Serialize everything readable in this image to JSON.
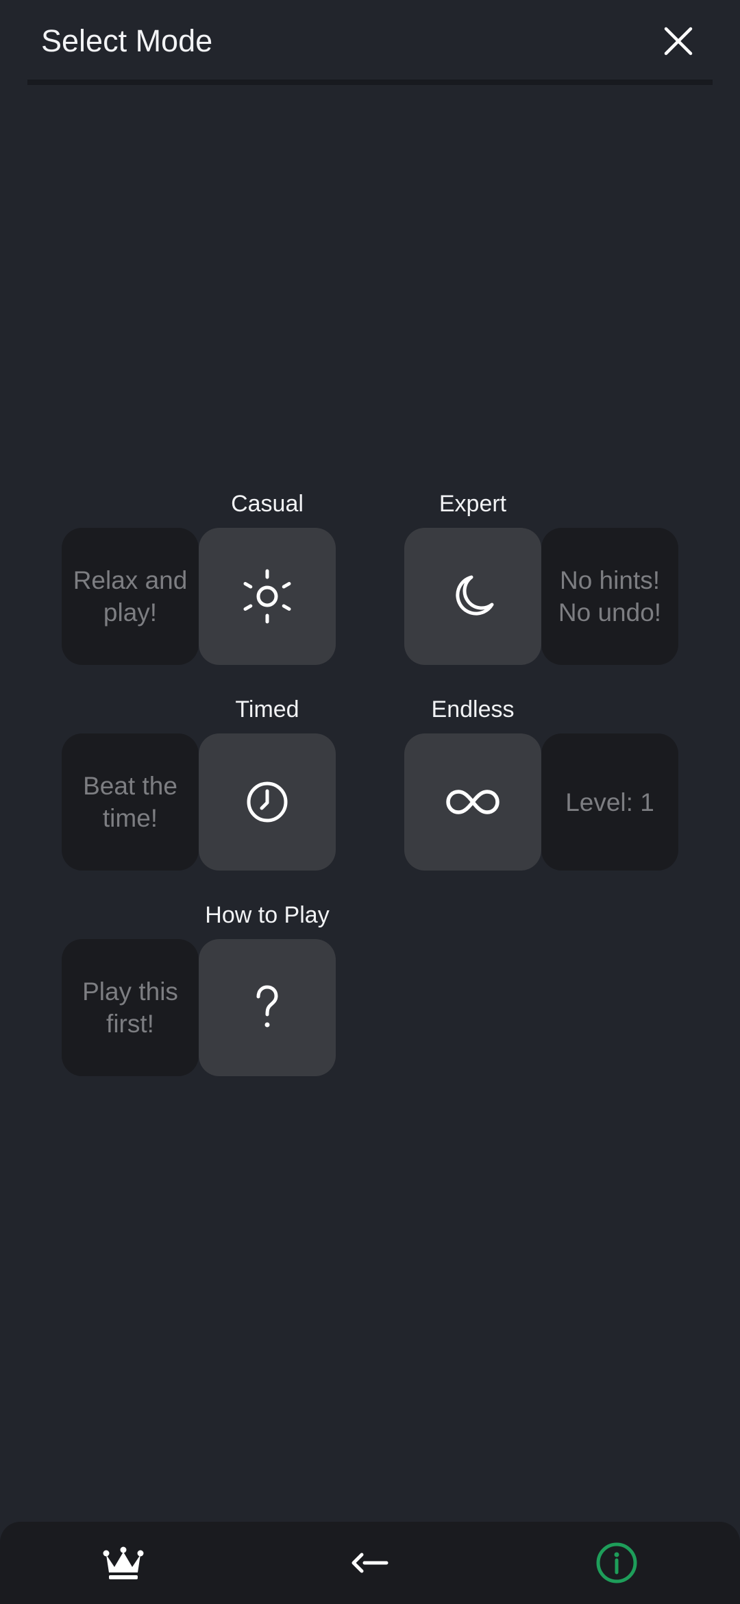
{
  "header": {
    "title": "Select Mode",
    "close_icon": "close-icon"
  },
  "modes": [
    {
      "id": "casual",
      "label": "Casual",
      "description": "Relax and play!",
      "icon": "sun-icon"
    },
    {
      "id": "expert",
      "label": "Expert",
      "description": "No hints! No undo!",
      "icon": "moon-icon"
    },
    {
      "id": "timed",
      "label": "Timed",
      "description": "Beat the time!",
      "icon": "clock-icon"
    },
    {
      "id": "endless",
      "label": "Endless",
      "description": "Level: 1",
      "icon": "infinity-icon"
    },
    {
      "id": "how-to-play",
      "label": "How to Play",
      "description": "Play this first!",
      "icon": "question-icon"
    }
  ],
  "bottom_nav": {
    "items": [
      {
        "name": "leaderboard",
        "icon": "crown-icon"
      },
      {
        "name": "back",
        "icon": "arrow-left-icon"
      },
      {
        "name": "info",
        "icon": "info-icon"
      }
    ]
  },
  "colors": {
    "background": "#22252c",
    "tile": "#3a3c41",
    "description_tile": "#1a1b1f",
    "description_text": "#7d7e82",
    "info_accent": "#1e9e5a"
  }
}
